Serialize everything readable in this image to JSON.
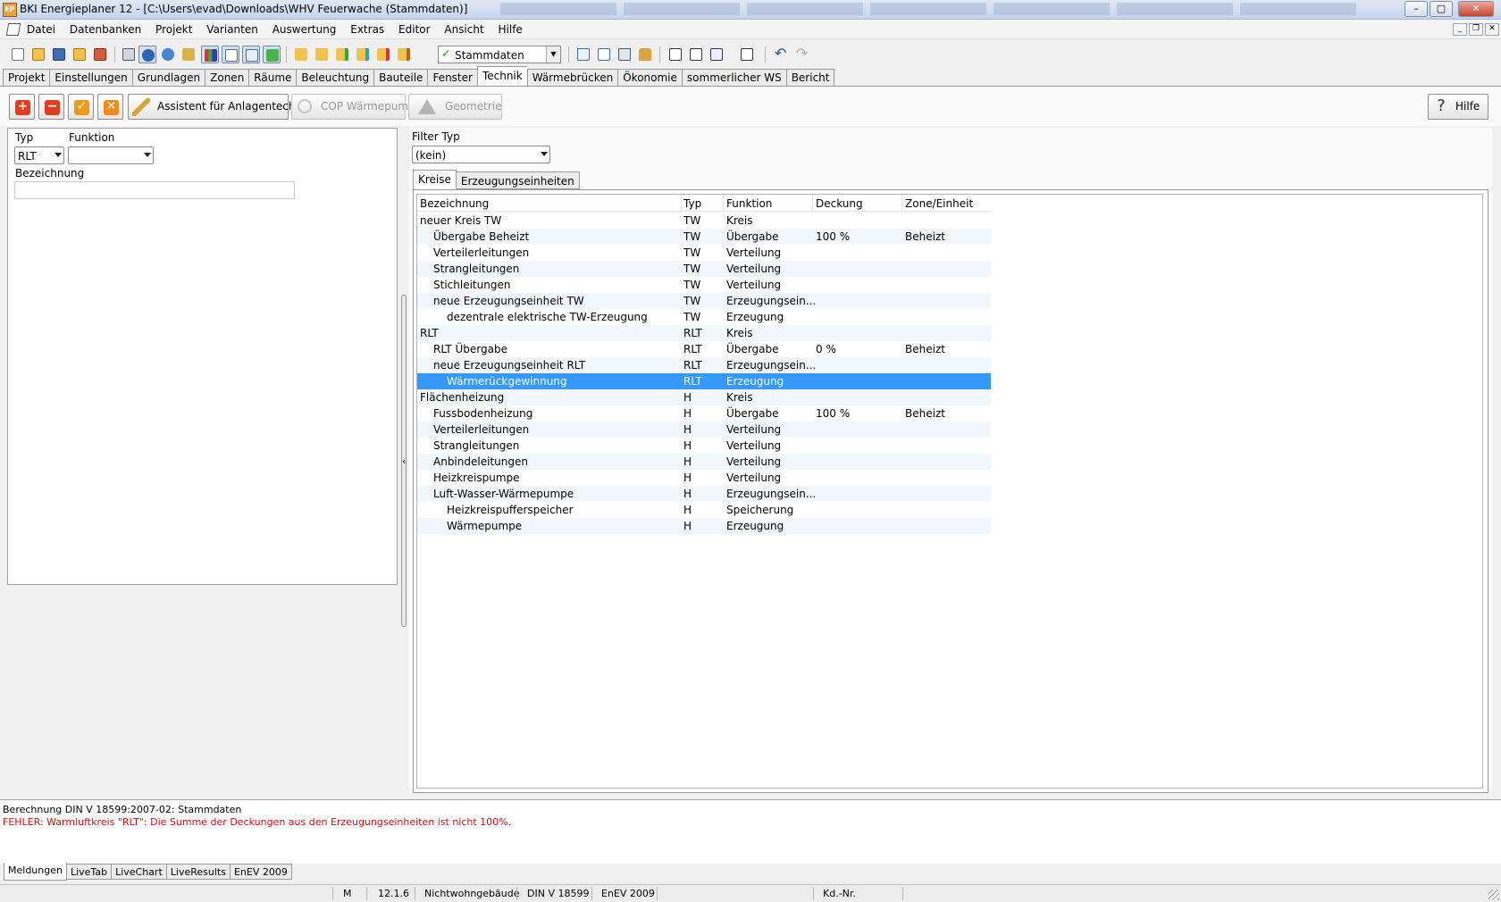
{
  "window": {
    "title": "BKI Energieplaner 12 - [C:\\Users\\evad\\Downloads\\WHV Feuerwache (Stammdaten)]",
    "app_icon_text": "EP"
  },
  "menu": [
    "Datei",
    "Datenbanken",
    "Projekt",
    "Varianten",
    "Auswertung",
    "Extras",
    "Editor",
    "Ansicht",
    "Hilfe"
  ],
  "toolbar": {
    "variant_value": "Stammdaten"
  },
  "main_tabs": [
    "Projekt",
    "Einstellungen",
    "Grundlagen",
    "Zonen",
    "Räume",
    "Beleuchtung",
    "Bauteile",
    "Fenster",
    "Technik",
    "Wärmebrücken",
    "Ökonomie",
    "sommerlicher WS",
    "Bericht"
  ],
  "active_main_tab": "Technik",
  "actions": {
    "assistant_label": "Assistent für Anlagentechnik",
    "cop_label": "COP Wärmepumpe",
    "geometry_label": "Geometrie",
    "help_label": "Hilfe"
  },
  "left_panel": {
    "typ_label": "Typ",
    "typ_value": "RLT",
    "funktion_label": "Funktion",
    "funktion_value": "",
    "bezeichnung_label": "Bezeichnung",
    "bezeichnung_value": ""
  },
  "right_panel": {
    "filter_label": "Filter Typ",
    "filter_value": "(kein)",
    "tabs": [
      "Kreise",
      "Erzeugungseinheiten"
    ],
    "active_tab": "Kreise"
  },
  "table": {
    "columns": [
      "Bezeichnung",
      "Typ",
      "Funktion",
      "Deckung",
      "Zone/Einheit"
    ],
    "rows": [
      {
        "name": "neuer Kreis TW",
        "indent": 0,
        "typ": "TW",
        "funktion": "Kreis",
        "deckung": "",
        "zone": ""
      },
      {
        "name": "Übergabe Beheizt",
        "indent": 1,
        "typ": "TW",
        "funktion": "Übergabe",
        "deckung": "100 %",
        "zone": "Beheizt"
      },
      {
        "name": "Verteilerleitungen",
        "indent": 1,
        "typ": "TW",
        "funktion": "Verteilung",
        "deckung": "",
        "zone": ""
      },
      {
        "name": "Strangleitungen",
        "indent": 1,
        "typ": "TW",
        "funktion": "Verteilung",
        "deckung": "",
        "zone": ""
      },
      {
        "name": "Stichleitungen",
        "indent": 1,
        "typ": "TW",
        "funktion": "Verteilung",
        "deckung": "",
        "zone": ""
      },
      {
        "name": "neue Erzeugungseinheit TW",
        "indent": 1,
        "typ": "TW",
        "funktion": "Erzeugungsein...",
        "deckung": "",
        "zone": ""
      },
      {
        "name": "dezentrale elektrische TW-Erzeugung",
        "indent": 2,
        "typ": "TW",
        "funktion": "Erzeugung",
        "deckung": "",
        "zone": ""
      },
      {
        "name": "RLT",
        "indent": 0,
        "typ": "RLT",
        "funktion": "Kreis",
        "deckung": "",
        "zone": ""
      },
      {
        "name": "RLT Übergabe",
        "indent": 1,
        "typ": "RLT",
        "funktion": "Übergabe",
        "deckung": "0 %",
        "zone": "Beheizt"
      },
      {
        "name": "neue Erzeugungseinheit RLT",
        "indent": 1,
        "typ": "RLT",
        "funktion": "Erzeugungsein...",
        "deckung": "",
        "zone": ""
      },
      {
        "name": "Wärmerückgewinnung",
        "indent": 2,
        "typ": "RLT",
        "funktion": "Erzeugung",
        "deckung": "",
        "zone": "",
        "selected": true
      },
      {
        "name": "Flächenheizung",
        "indent": 0,
        "typ": "H",
        "funktion": "Kreis",
        "deckung": "",
        "zone": ""
      },
      {
        "name": "Fussbodenheizung",
        "indent": 1,
        "typ": "H",
        "funktion": "Übergabe",
        "deckung": "100 %",
        "zone": "Beheizt"
      },
      {
        "name": "Verteilerleitungen",
        "indent": 1,
        "typ": "H",
        "funktion": "Verteilung",
        "deckung": "",
        "zone": ""
      },
      {
        "name": "Strangleitungen",
        "indent": 1,
        "typ": "H",
        "funktion": "Verteilung",
        "deckung": "",
        "zone": ""
      },
      {
        "name": "Anbindeleitungen",
        "indent": 1,
        "typ": "H",
        "funktion": "Verteilung",
        "deckung": "",
        "zone": ""
      },
      {
        "name": "Heizkreispumpe",
        "indent": 1,
        "typ": "H",
        "funktion": "Verteilung",
        "deckung": "",
        "zone": ""
      },
      {
        "name": "Luft-Wasser-Wärmepumpe",
        "indent": 1,
        "typ": "H",
        "funktion": "Erzeugungsein...",
        "deckung": "",
        "zone": ""
      },
      {
        "name": "Heizkreispufferspeicher",
        "indent": 2,
        "typ": "H",
        "funktion": "Speicherung",
        "deckung": "",
        "zone": ""
      },
      {
        "name": "Wärmepumpe",
        "indent": 2,
        "typ": "H",
        "funktion": "Erzeugung",
        "deckung": "",
        "zone": ""
      }
    ]
  },
  "messages": {
    "line1": "Berechnung DIN V 18599:2007-02: Stammdaten",
    "line2": "FEHLER: Warmluftkreis \"RLT\": Die Summe der Deckungen aus den Erzeugungseinheiten ist nicht 100%."
  },
  "bottom_tabs": [
    "Meldungen",
    "LiveTab",
    "LiveChart",
    "LiveResults",
    "EnEV 2009"
  ],
  "active_bottom_tab": "Meldungen",
  "statusbar": [
    "M",
    "12.1.6",
    "Nichtwohngebäude",
    "DIN V 18599",
    "EnEV 2009",
    "Kd.-Nr."
  ],
  "colors": {
    "selection": "#3399ff",
    "error_text": "#d01010",
    "add_button": "#e53a1e",
    "remove_button": "#e0401f",
    "ok_button": "#f09a1a",
    "cancel_button": "#f08a1a"
  }
}
